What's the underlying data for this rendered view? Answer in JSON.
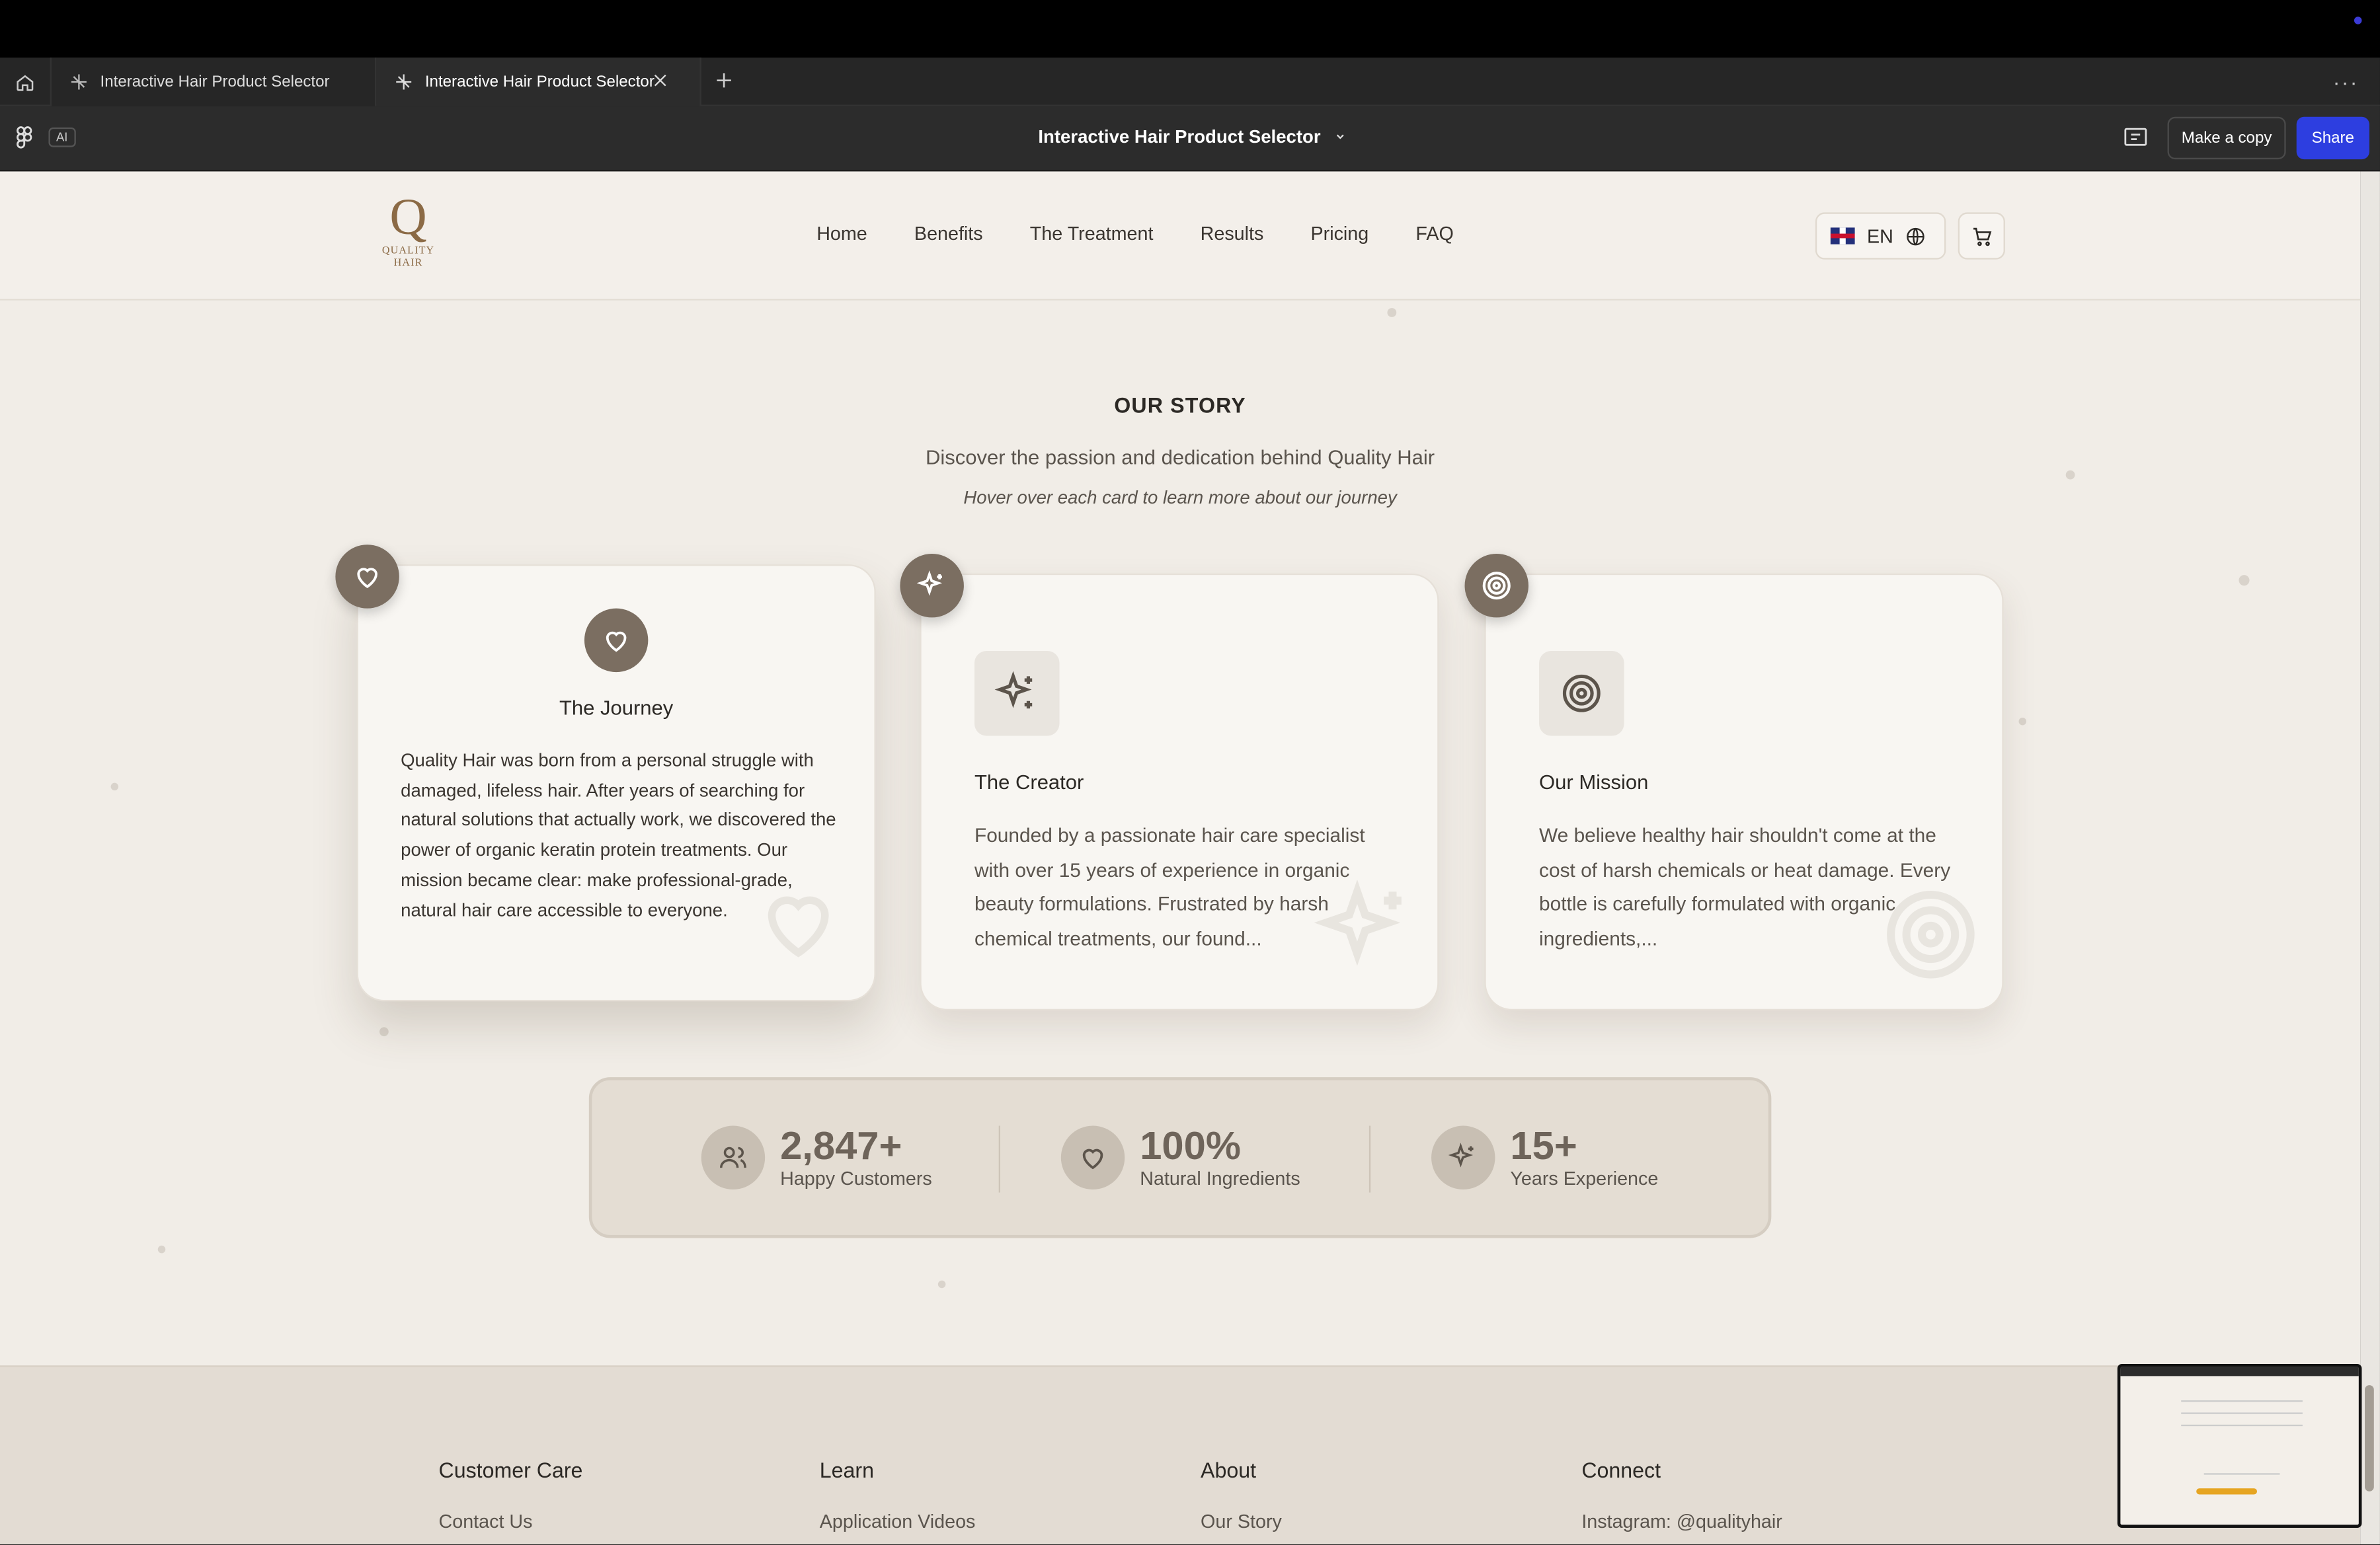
{
  "browser": {
    "tabs": [
      {
        "label": "Interactive Hair Product Selector"
      },
      {
        "label": "Interactive Hair Product Selector"
      }
    ],
    "toolbar": {
      "ai_label": "AI",
      "file_title": "Interactive Hair Product Selector",
      "make_copy_label": "Make a copy",
      "share_label": "Share"
    }
  },
  "site": {
    "logo": {
      "letter": "Q",
      "word1": "QUALITY",
      "word2": "HAIR"
    },
    "nav": [
      "Home",
      "Benefits",
      "The Treatment",
      "Results",
      "Pricing",
      "FAQ"
    ],
    "language": "EN"
  },
  "story": {
    "title": "OUR STORY",
    "subtitle": "Discover the passion and dedication behind Quality Hair",
    "hint": "Hover over each card to learn more about our journey",
    "cards": [
      {
        "title": "The Journey",
        "icon": "heart-icon",
        "body": "Quality Hair was born from a personal struggle with damaged, lifeless hair. After years of searching for natural solutions that actually work, we discovered the power of organic keratin protein treatments. Our mission became clear: make professional-grade, natural hair care accessible to everyone."
      },
      {
        "title": "The Creator",
        "icon": "sparkles-icon",
        "body": "Founded by a passionate hair care specialist with over 15 years of experience in organic beauty formulations. Frustrated by harsh chemical treatments, our found..."
      },
      {
        "title": "Our Mission",
        "icon": "target-icon",
        "body": "We believe healthy hair shouldn't come at the cost of harsh chemicals or heat damage. Every bottle is carefully formulated with organic ingredients,..."
      }
    ]
  },
  "stats": [
    {
      "value": "2,847+",
      "label": "Happy Customers",
      "icon": "users-icon"
    },
    {
      "value": "100%",
      "label": "Natural Ingredients",
      "icon": "heart-icon"
    },
    {
      "value": "15+",
      "label": "Years Experience",
      "icon": "sparkles-icon"
    }
  ],
  "footer": {
    "columns": [
      {
        "heading": "Customer Care",
        "link": "Contact Us"
      },
      {
        "heading": "Learn",
        "link": "Application Videos"
      },
      {
        "heading": "About",
        "link": "Our Story"
      },
      {
        "heading": "Connect",
        "link": "Instagram: @qualityhair"
      }
    ]
  },
  "colors": {
    "accent": "#7b6e61",
    "share_button": "#2d3ee0",
    "background": "#f1ede7"
  }
}
